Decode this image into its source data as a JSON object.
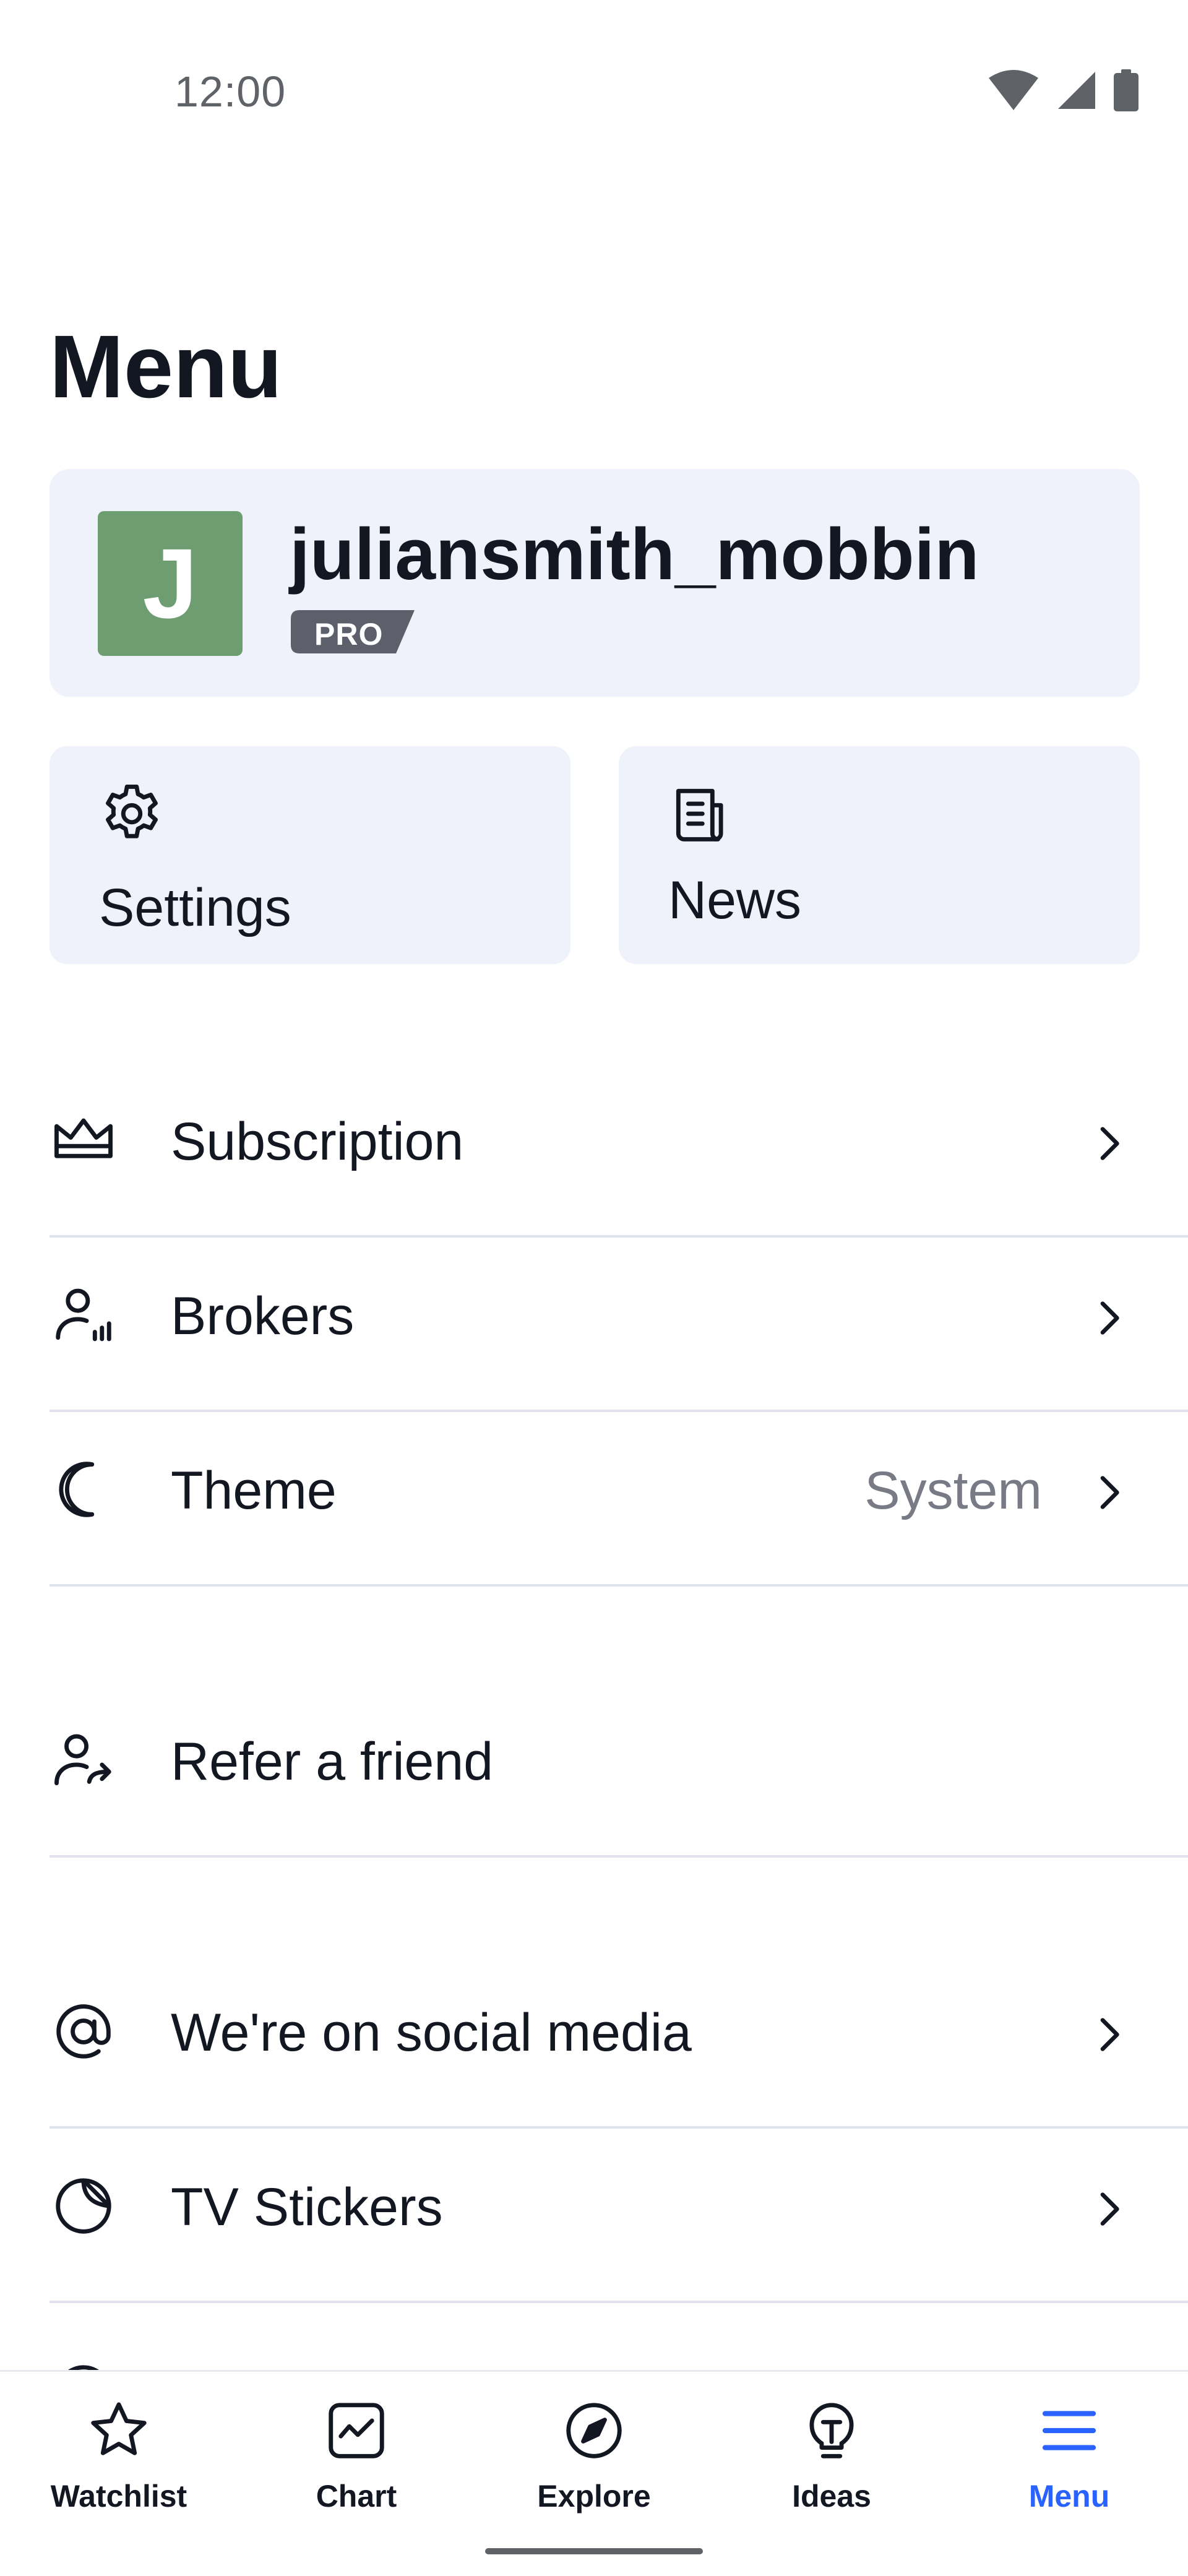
{
  "status_bar": {
    "time": "12:00",
    "icons": [
      "wifi-icon",
      "cellular-signal-icon",
      "battery-icon"
    ]
  },
  "page": {
    "title": "Menu"
  },
  "profile": {
    "avatar_initial": "J",
    "avatar_color": "#6d9d71",
    "username": "juliansmith_mobbin",
    "badge": "PRO"
  },
  "tiles": {
    "settings": {
      "label": "Settings",
      "icon": "gear-icon"
    },
    "news": {
      "label": "News",
      "icon": "newspaper-icon"
    }
  },
  "menu_items": {
    "subscription": {
      "label": "Subscription",
      "icon": "crown-icon"
    },
    "brokers": {
      "label": "Brokers",
      "icon": "broker-icon"
    },
    "theme": {
      "label": "Theme",
      "value": "System",
      "icon": "moon-icon"
    },
    "refer": {
      "label": "Refer a friend",
      "icon": "refer-user-icon"
    },
    "social": {
      "label": "We're on social media",
      "icon": "at-sign-icon"
    },
    "stickers": {
      "label": "TV Stickers",
      "icon": "sticker-icon"
    }
  },
  "bottom_nav": {
    "active": "menu",
    "accent_color": "#2962ff",
    "items": [
      {
        "id": "watchlist",
        "label": "Watchlist",
        "icon": "star-icon"
      },
      {
        "id": "chart",
        "label": "Chart",
        "icon": "chart-icon"
      },
      {
        "id": "explore",
        "label": "Explore",
        "icon": "compass-icon"
      },
      {
        "id": "ideas",
        "label": "Ideas",
        "icon": "lightbulb-icon"
      },
      {
        "id": "menu",
        "label": "Menu",
        "icon": "hamburger-icon"
      }
    ]
  },
  "colors": {
    "card_background": "#eff2fa",
    "text_primary": "#131722",
    "text_secondary": "#787b86",
    "divider": "#e0e3eb",
    "badge_background": "#5d606b"
  }
}
